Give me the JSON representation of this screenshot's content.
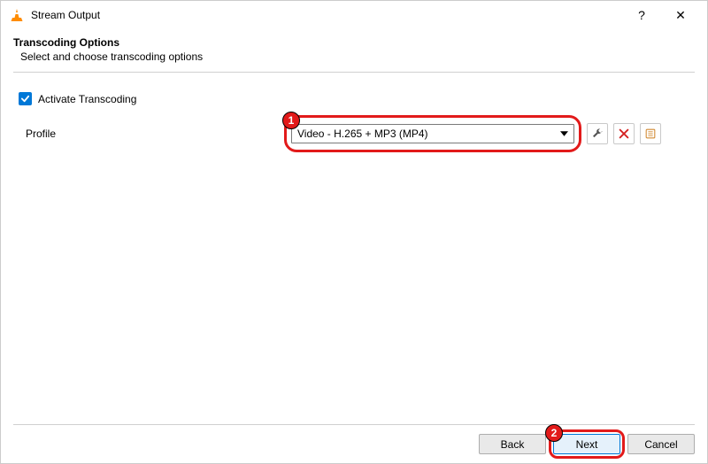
{
  "window": {
    "title": "Stream Output",
    "help_label": "?",
    "close_label": "✕"
  },
  "section": {
    "title": "Transcoding Options",
    "subtitle": "Select and choose transcoding options"
  },
  "transcoding": {
    "checkbox_label": "Activate Transcoding",
    "checked": true
  },
  "profile": {
    "label": "Profile",
    "selected": "Video - H.265 + MP3 (MP4)"
  },
  "tool_icons": {
    "wrench": "wrench-icon",
    "delete": "delete-icon",
    "new": "new-profile-icon"
  },
  "buttons": {
    "back": "Back",
    "next": "Next",
    "cancel": "Cancel"
  },
  "callouts": {
    "profile": "1",
    "next": "2"
  }
}
